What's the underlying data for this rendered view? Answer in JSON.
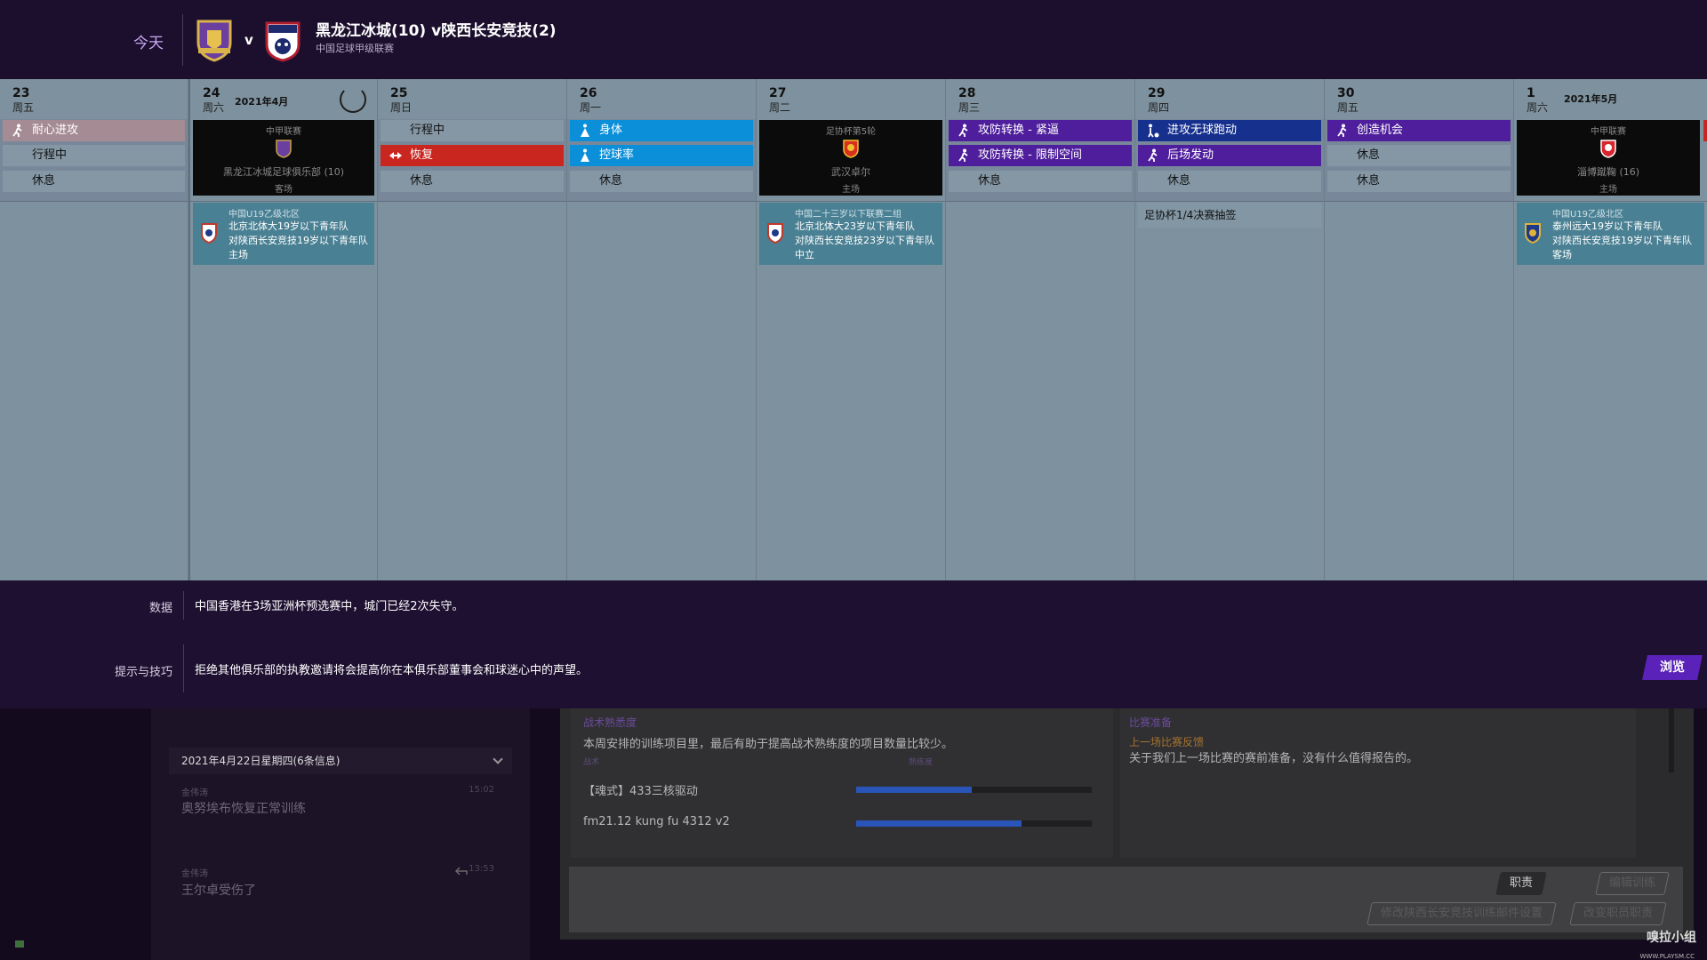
{
  "header": {
    "today_label": "今天",
    "vs": "v",
    "match_title": "黑龙江冰城(10) v陕西长安竞技(2)",
    "competition": "中国足球甲级联赛",
    "colors": {
      "bg": "#1c0f2e",
      "accent": "#c9a7f0"
    }
  },
  "calendar": {
    "days": [
      {
        "num": "23",
        "weekday": "周五",
        "sessions": [
          "耐心进攻",
          "行程中",
          "休息"
        ]
      },
      {
        "num": "24",
        "weekday": "周六",
        "month": "2021年4月",
        "match": {
          "competition": "中甲联赛",
          "opponent": "黑龙江冰城足球俱乐部 (10)",
          "venue": "客场"
        },
        "youth": {
          "competition": "中国U19乙级北区",
          "line1": "北京北体大19岁以下青年队",
          "line2": "对陕西长安竞技19岁以下青年队",
          "line3": "主场"
        }
      },
      {
        "num": "25",
        "weekday": "周日",
        "sessions": [
          "行程中",
          "恢复",
          "休息"
        ]
      },
      {
        "num": "26",
        "weekday": "周一",
        "sessions": [
          "身体",
          "控球率",
          "休息"
        ]
      },
      {
        "num": "27",
        "weekday": "周二",
        "match": {
          "competition": "足协杯第5轮",
          "opponent": "武汉卓尔",
          "venue": "主场"
        },
        "youth": {
          "competition": "中国二十三岁以下联赛二组",
          "line1": "北京北体大23岁以下青年队",
          "line2": "对陕西长安竞技23岁以下青年队",
          "line3": "中立"
        }
      },
      {
        "num": "28",
        "weekday": "周三",
        "sessions": [
          "攻防转换 - 紧逼",
          "攻防转换 - 限制空间",
          "休息"
        ]
      },
      {
        "num": "29",
        "weekday": "周四",
        "sessions": [
          "进攻无球跑动",
          "后场发动",
          "休息"
        ],
        "note": "足协杯1/4决赛抽签"
      },
      {
        "num": "30",
        "weekday": "周五",
        "sessions": [
          "创造机会",
          "休息",
          "休息"
        ]
      },
      {
        "num": "1",
        "weekday": "周六",
        "month": "2021年5月",
        "match": {
          "competition": "中甲联赛",
          "opponent": "淄博蹴鞠 (16)",
          "venue": "主场"
        },
        "youth": {
          "competition": "中国U19乙级北区",
          "line1": "泰州远大19岁以下青年队",
          "line2": "对陕西长安竞技19岁以下青年队",
          "line3": "客场"
        }
      }
    ],
    "colors": {
      "bg": "#7e919e",
      "blue": "#0b8fd9",
      "red": "#c9261f",
      "purple": "#4f1e9c",
      "navy": "#16308e"
    }
  },
  "info": {
    "data_label": "数据",
    "data_text": "中国香港在3场亚洲杯预选赛中，城门已经2次失守。",
    "tips_label": "提示与技巧",
    "tips_text": "拒绝其他俱乐部的执教邀请将会提高你在本俱乐部董事会和球迷心中的声望。",
    "browse_label": "浏览"
  },
  "inbox": {
    "date_header": "2021年4月22日星期四(6条信息)",
    "messages": [
      {
        "sender": "金伟涛",
        "time": "15:02",
        "text": "奥努埃布恢复正常训练"
      },
      {
        "sender": "金伟涛",
        "time": "13:53",
        "text": "王尔卓受伤了"
      }
    ]
  },
  "main": {
    "familiarity_title": "战术熟悉度",
    "familiarity_text": "本周安排的训练项目里，最后有助于提高战术熟练度的项目数量比较少。",
    "col_tactic": "战术",
    "col_familiarity": "熟练度",
    "tactics": [
      {
        "name": "【魂式】433三核驱动",
        "level": 0.49
      },
      {
        "name": "fm21.12 kung fu 4312 v2",
        "level": 0.7
      }
    ],
    "prep_title": "比赛准备",
    "prep_subtitle": "上一场比赛反馈",
    "prep_text": "关于我们上一场比赛的赛前准备，没有什么值得报告的。"
  },
  "actions": {
    "duties": "职责",
    "edit_training": "编辑训练",
    "change_email": "修改陕西长安竞技训练邮件设置",
    "change_staff": "改变职员职责"
  },
  "watermark": {
    "title": "嗅拉小组",
    "url": "WWW.PLAYSM.CC"
  }
}
